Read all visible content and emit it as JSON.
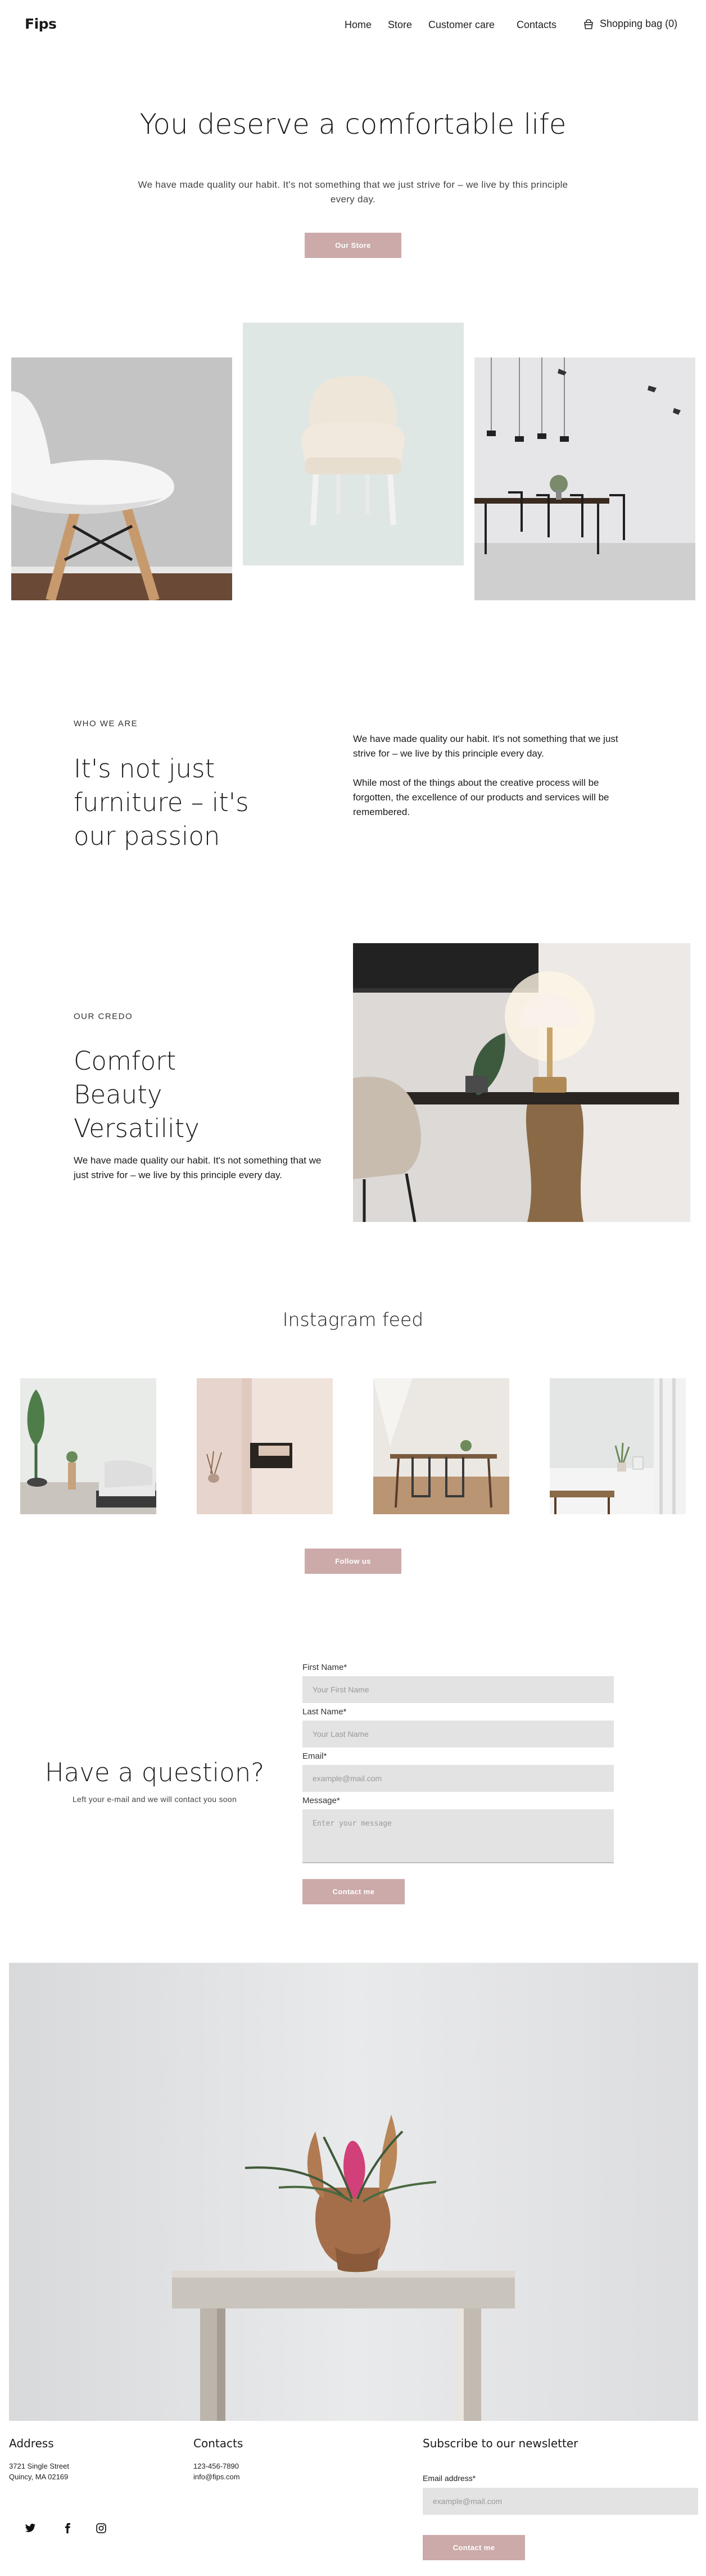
{
  "header": {
    "logo": "Fips",
    "nav": [
      "Home",
      "Store",
      "Customer care",
      "Contacts"
    ],
    "bag_label": "Shopping bag (0)"
  },
  "hero": {
    "title": "You deserve a comfortable life",
    "subtitle": "We have made quality our habit. It's not something that we just strive for – we live by this principle every day.",
    "button": "Our Store"
  },
  "about": {
    "eyebrow": "WHO WE ARE",
    "heading_lines": [
      "It's not just",
      "furniture – it's",
      "our passion"
    ],
    "paragraph1": "We have made quality our habit. It's not something that we just strive for – we live by this principle every day.",
    "paragraph2": "While most of the things about the creative process will be forgotten, the excellence of our products and services will be remembered."
  },
  "credo": {
    "eyebrow": "OUR CREDO",
    "heading_lines": [
      "Comfort",
      "Beauty",
      "Versatility"
    ],
    "paragraph": "We have made quality our habit. It's not something that we just strive for – we live by this principle every day."
  },
  "instagram": {
    "title": "Instagram feed",
    "button": "Follow us"
  },
  "contact": {
    "title": "Have a question?",
    "subtitle": "Left your e-mail and we will contact you soon",
    "first_name_label": "First Name*",
    "first_name_placeholder": "Your First Name",
    "last_name_label": "Last Name*",
    "last_name_placeholder": "Your Last Name",
    "email_label": "Email*",
    "email_placeholder": "example@mail.com",
    "message_label": "Message*",
    "message_placeholder": "Enter your message",
    "button": "Contact me"
  },
  "footer": {
    "address_title": "Address",
    "address_line1": "3721 Single Street",
    "address_line2": "Quincy, MA 02169",
    "contacts_title": "Contacts",
    "phone": "123-456-7890",
    "email": "info@fips.com",
    "newsletter_title": "Subscribe to our newsletter",
    "newsletter_label": "Email address*",
    "newsletter_placeholder": "example@mail.com",
    "newsletter_button": "Contact me",
    "social": [
      "twitter-icon",
      "facebook-icon",
      "instagram-icon"
    ]
  },
  "colors": {
    "accent": "#ccaaaa",
    "input_bg": "#e3e3e3"
  }
}
